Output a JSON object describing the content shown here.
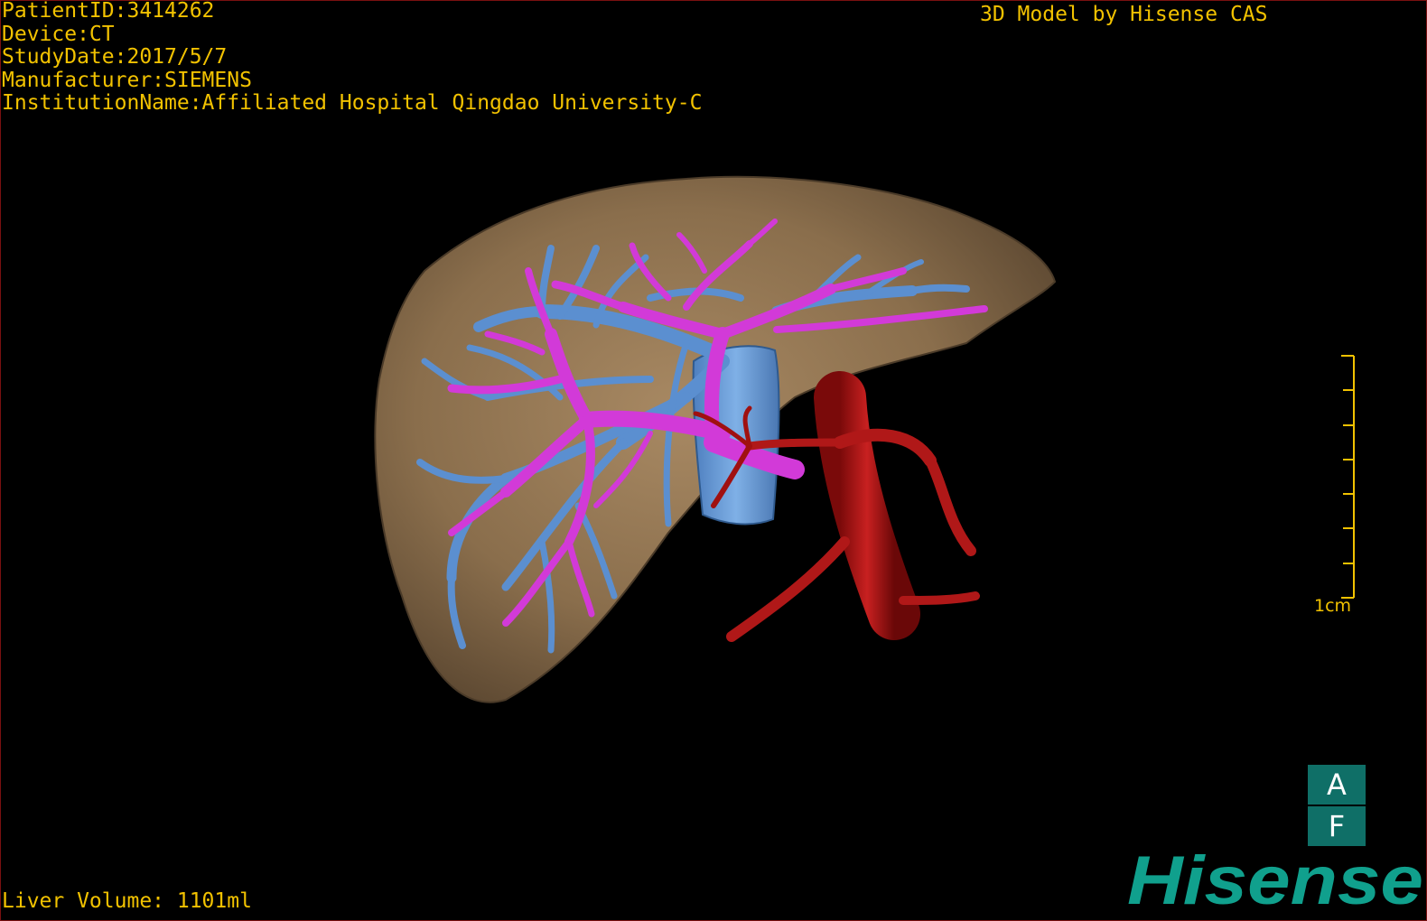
{
  "header": {
    "patient_id": "PatientID:3414262",
    "device": "Device:CT",
    "study_date": "StudyDate:2017/5/7",
    "manufacturer": "Manufacturer:SIEMENS",
    "institution": "InstitutionName:Affiliated Hospital Qingdao University-C"
  },
  "credit": "3D Model by Hisense CAS",
  "footer": {
    "liver_volume": "Liver Volume: 1101ml"
  },
  "scale": {
    "label": "1cm"
  },
  "orientation": {
    "top": "A",
    "bottom": "F"
  },
  "logo": {
    "text": "Hisense"
  },
  "model": {
    "structures": [
      {
        "name": "liver",
        "color": "#8e7350"
      },
      {
        "name": "hepatic-vein",
        "color": "#5b8fd0"
      },
      {
        "name": "portal-vein",
        "color": "#d23ad8"
      },
      {
        "name": "hepatic-artery",
        "color": "#b01818"
      },
      {
        "name": "inferior-vena-cava",
        "color": "#6fa0d8"
      }
    ]
  }
}
